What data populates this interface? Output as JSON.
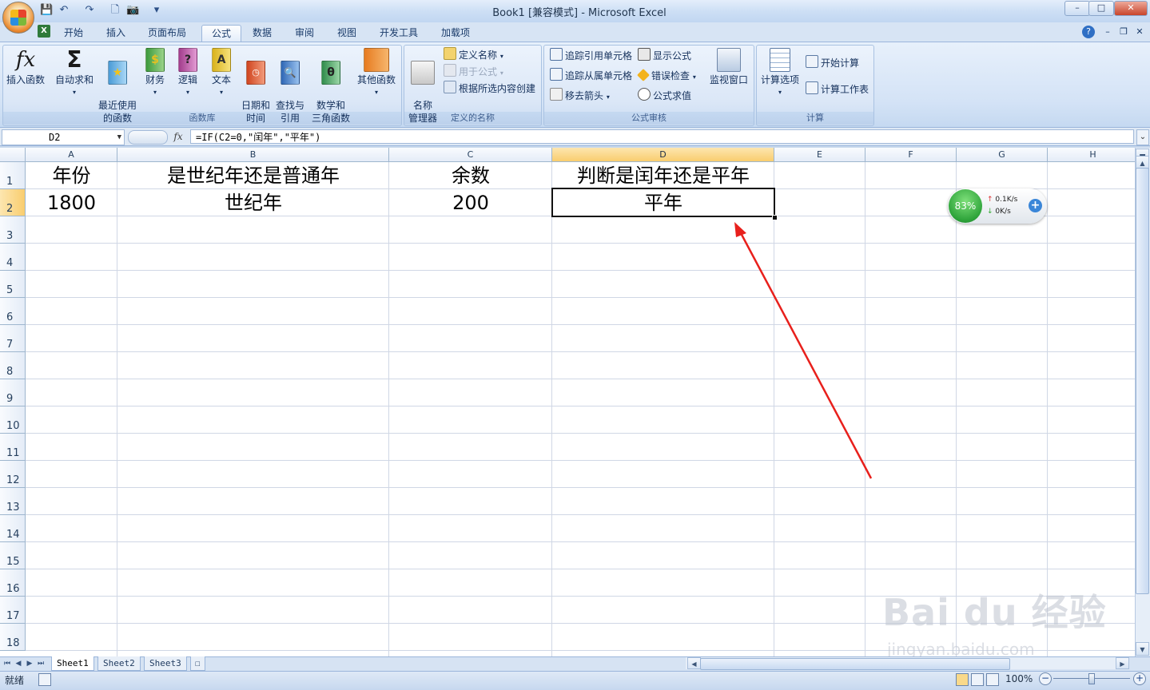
{
  "window": {
    "title": "Book1  [兼容模式] - Microsoft Excel",
    "controls": {
      "minimize": "–",
      "maximize": "□",
      "close": "✕"
    }
  },
  "quick_access": {
    "save": "💾",
    "undo": "↶",
    "redo": "↷",
    "print_preview": "🗋",
    "camera": "📷",
    "more": "▾"
  },
  "tabs": [
    "开始",
    "插入",
    "页面布局",
    "公式",
    "数据",
    "审阅",
    "视图",
    "开发工具",
    "加载项"
  ],
  "active_tab": "公式",
  "ribbon": {
    "function_library": {
      "label": "函数库",
      "insert_function": "插入函数",
      "autosum": "自动求和",
      "recent": "最近使用\n的函数",
      "financial": "财务",
      "logical": "逻辑",
      "text": "文本",
      "datetime": "日期和\n时间",
      "lookup": "查找与\n引用",
      "math": "数学和\n三角函数",
      "more_functions": "其他函数"
    },
    "defined_names": {
      "label": "定义的名称",
      "name_manager": "名称\n管理器",
      "define_name": "定义名称",
      "use_in_formula": "用于公式",
      "create_from_selection": "根据所选内容创建"
    },
    "formula_auditing": {
      "label": "公式审核",
      "trace_precedents": "追踪引用单元格",
      "trace_dependents": "追踪从属单元格",
      "remove_arrows": "移去箭头",
      "show_formulas": "显示公式",
      "error_checking": "错误检查",
      "evaluate_formula": "公式求值",
      "watch_window": "监视窗口"
    },
    "calculation": {
      "label": "计算",
      "calc_options": "计算选项",
      "calc_now": "开始计算",
      "calc_sheet": "计算工作表"
    }
  },
  "formula_bar": {
    "name_box": "D2",
    "fx": "fx",
    "formula": "=IF(C2=0,\"闰年\",\"平年\")"
  },
  "columns": [
    "A",
    "B",
    "C",
    "D",
    "E",
    "F",
    "G",
    "H"
  ],
  "rows": [
    "1",
    "2",
    "3",
    "4",
    "5",
    "6",
    "7",
    "8",
    "9",
    "10",
    "11",
    "12",
    "13",
    "14",
    "15",
    "16",
    "17",
    "18"
  ],
  "cells": {
    "A1": "年份",
    "B1": "是世纪年还是普通年",
    "C1": "余数",
    "D1": "判断是闰年还是平年",
    "A2": "1800",
    "B2": "世纪年",
    "C2": "200",
    "D2": "平年"
  },
  "selected_cell": "D2",
  "sheets": [
    "Sheet1",
    "Sheet2",
    "Sheet3"
  ],
  "active_sheet": "Sheet1",
  "status": {
    "ready": "就绪",
    "zoom": "100%"
  },
  "net_widget": {
    "percent": "83%",
    "up": "0.1K/s",
    "down": "0K/s"
  },
  "watermark": {
    "brand": "Bai du 经验",
    "url": "jingyan.baidu.com"
  },
  "colors": {
    "annotation_arrow": "#e8201c",
    "selection_header": "#f9cd6e"
  }
}
